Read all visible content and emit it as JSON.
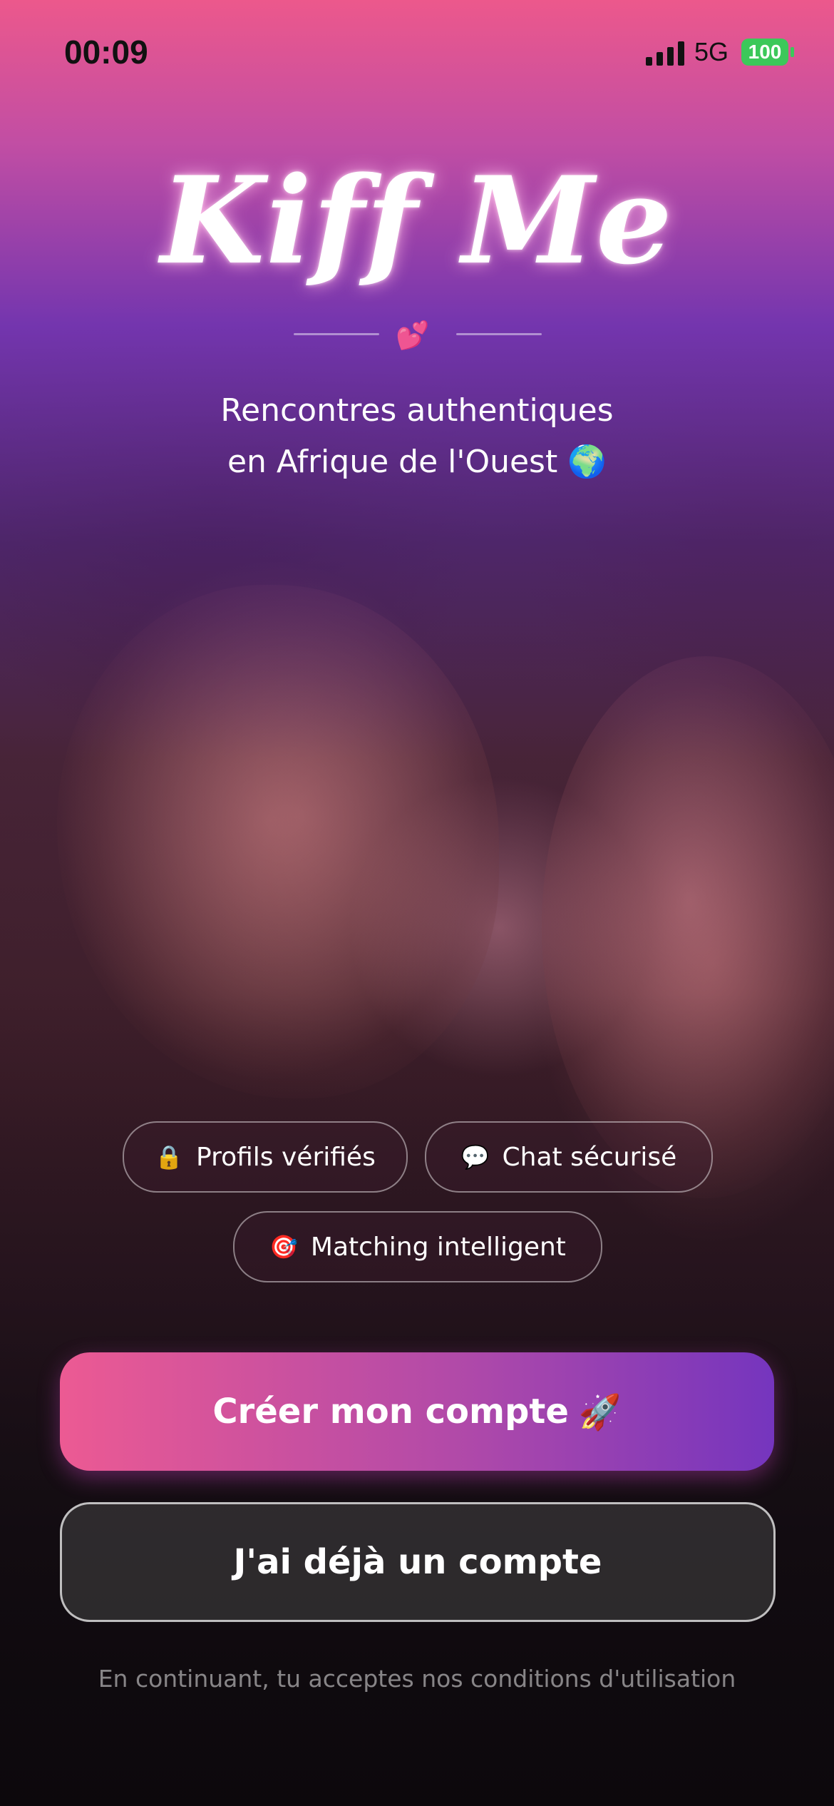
{
  "status_bar": {
    "time": "00:09",
    "network": "5G",
    "battery": "100",
    "signal_icon": "signal-bars-icon"
  },
  "brand": {
    "logo_text": "Kiff Me",
    "divider_icon": "two-hearts"
  },
  "tagline": {
    "line1": "Rencontres authentiques",
    "line2": "en Afrique de l'Ouest",
    "line2_icon": "globe-africa"
  },
  "features": [
    {
      "icon": "lock",
      "label": "Profils vérifiés"
    },
    {
      "icon": "speech-bubble",
      "label": "Chat sécurisé"
    },
    {
      "icon": "target",
      "label": "Matching intelligent"
    }
  ],
  "actions": {
    "create_account": "Créer mon compte",
    "create_account_icon": "rocket",
    "login": "J'ai déjà un compte"
  },
  "footer": {
    "terms": "En continuant, tu acceptes nos conditions d'utilisation"
  },
  "colors": {
    "primary_gradient_start": "#ec5a93",
    "primary_gradient_end": "#7535be",
    "header_pink": "#ec588c",
    "header_purple": "#7837b9"
  }
}
